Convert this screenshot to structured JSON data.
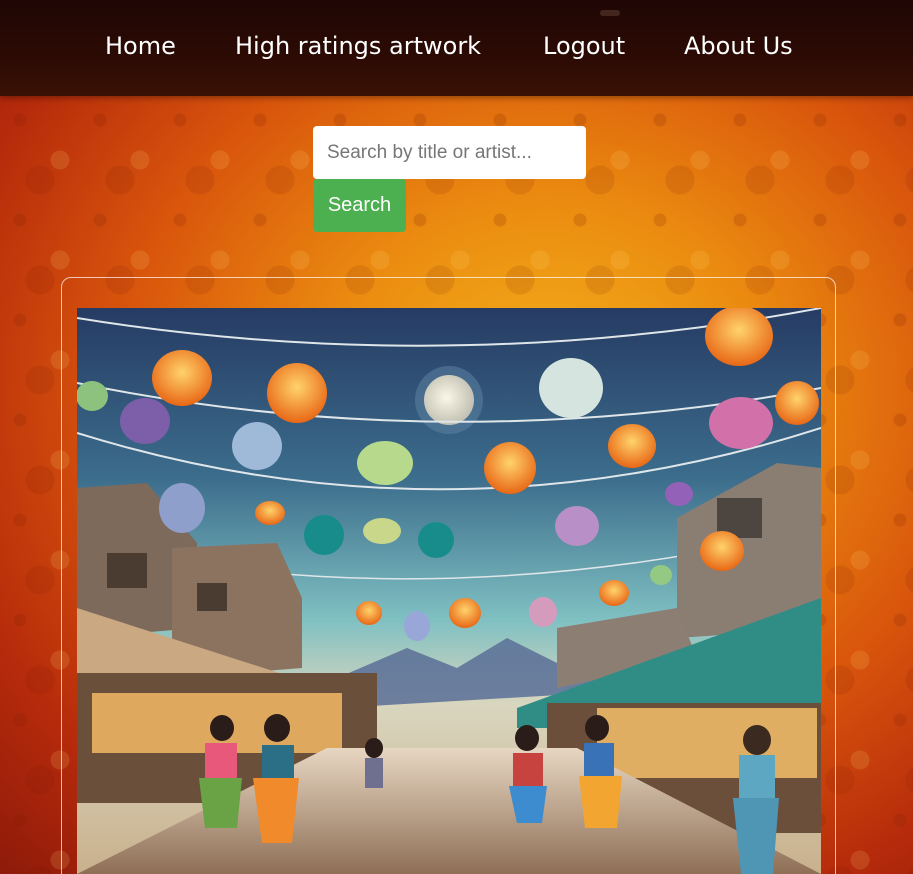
{
  "nav": {
    "items": [
      {
        "label": "Home"
      },
      {
        "label": "High ratings artwork"
      },
      {
        "label": "Logout"
      },
      {
        "label": "About Us"
      }
    ]
  },
  "search": {
    "placeholder": "Search by title or artist...",
    "value": "",
    "button_label": "Search"
  },
  "artwork": {
    "image_icon": "market-lanterns-painting"
  },
  "colors": {
    "nav_bg": "#2c0a04",
    "search_button": "#4caf50",
    "background_accent": "#eb8c10"
  }
}
